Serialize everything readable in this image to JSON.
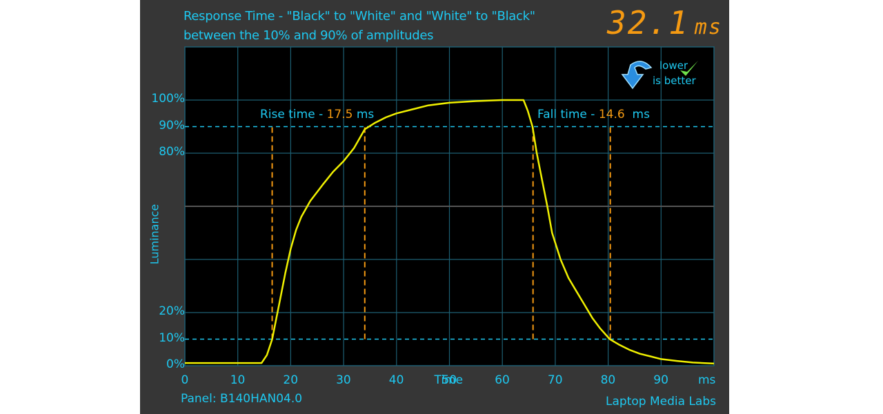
{
  "title_line1": "Response Time - \"Black\" to \"White\" and \"White\" to \"Black\"",
  "title_line2": "between the 10% and 90% of amplitudes",
  "display": {
    "value": "32.1",
    "unit": "ms"
  },
  "badge": {
    "line1": "lower",
    "line2": "is better",
    "icon": "arrow-down-check-icon"
  },
  "footer": {
    "panel": "Panel: B140HAN04.0",
    "brand": "Laptop Media Labs"
  },
  "annotations": {
    "rise_label": "Rise time - ",
    "rise_value": "17.5",
    "rise_unit": " ms",
    "fall_label": "Fall time - ",
    "fall_value": "14.6",
    "fall_unit": "  ms"
  },
  "colors": {
    "background": "#363636",
    "plot": "#000000",
    "text": "#1ec8f0",
    "curve": "#f0f000",
    "marker": "#f59a12",
    "grid": "#1d5f73"
  },
  "chart_data": {
    "type": "line",
    "xlabel": "Time",
    "ylabel": "Luminance",
    "xlim": [
      0,
      100
    ],
    "ylim": [
      0,
      120
    ],
    "x_ticks": [
      "0",
      "10",
      "20",
      "30",
      "40",
      "50",
      "60",
      "70",
      "80",
      "90"
    ],
    "x_tick_values": [
      0,
      10,
      20,
      30,
      40,
      50,
      60,
      70,
      80,
      90
    ],
    "x_unit_label": "ms",
    "y_ticks": [
      "0%",
      "10%",
      "20%",
      "80%",
      "90%",
      "100%"
    ],
    "y_tick_values": [
      0,
      10,
      20,
      80,
      90,
      100
    ],
    "grid": true,
    "reference_lines_y": [
      10,
      90
    ],
    "marker_lines": [
      {
        "x": 16.5,
        "y_from": 10,
        "y_to": 90
      },
      {
        "x": 34,
        "y_from": 10,
        "y_to": 90
      },
      {
        "x": 65.8,
        "y_from": 10,
        "y_to": 90
      },
      {
        "x": 80.4,
        "y_from": 10,
        "y_to": 90
      }
    ],
    "series": [
      {
        "x": [
          0,
          14.5,
          15.5,
          16.5,
          17.3,
          18,
          19,
          20,
          21,
          22,
          23.7,
          26,
          28,
          30,
          32,
          34,
          36,
          38,
          40,
          43,
          46,
          50,
          55,
          60,
          64,
          64.8,
          65.7,
          66.5,
          67.5,
          68.5,
          69.4,
          71,
          72.5,
          74,
          75.5,
          77,
          78.5,
          80.3,
          82,
          84,
          86,
          88,
          90,
          93,
          96,
          100
        ],
        "y": [
          1,
          1,
          4,
          10,
          18,
          25,
          35,
          44,
          51,
          56,
          62,
          68,
          73,
          77,
          82,
          89,
          91.5,
          93.5,
          95,
          96.5,
          98,
          99,
          99.6,
          100,
          100,
          96,
          90,
          80,
          70,
          60,
          50,
          40,
          33,
          28,
          23,
          18,
          14,
          10,
          8,
          6,
          4.5,
          3.5,
          2.5,
          1.8,
          1.2,
          0.8
        ]
      }
    ]
  }
}
